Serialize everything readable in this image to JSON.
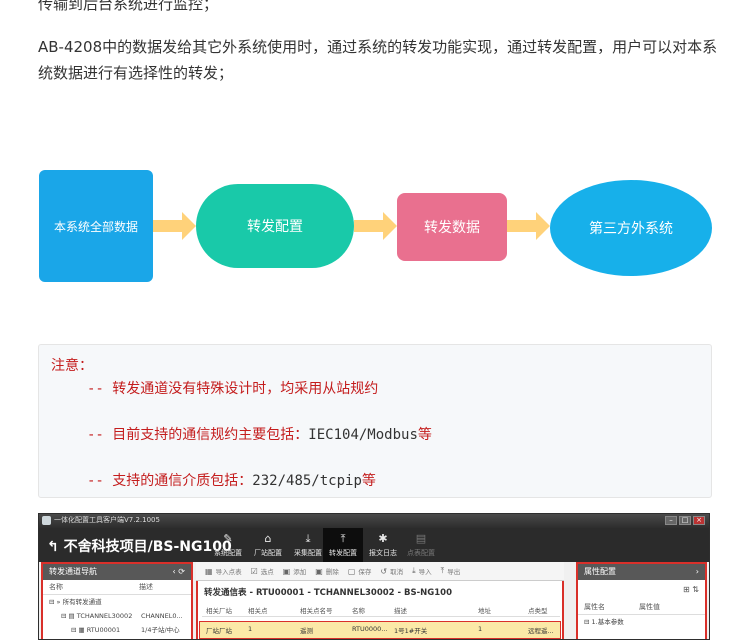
{
  "paragraphs": {
    "p1": "传输到后台系统进行监控；",
    "p2": "AB-4208中的数据发给其它外系统使用时，通过系统的转发功能实现，通过转发配置，用户可以对本系统数据进行有选择性的转发；"
  },
  "flow": {
    "nodes": [
      "本系统全部数据",
      "转发配置",
      "转发数据",
      "第三方外系统"
    ],
    "colors": {
      "node1": "#1aa6e8",
      "node2": "#19c9a9",
      "node3": "#e9708f",
      "node4": "#17b0ea",
      "arrow": "#ffd27a"
    }
  },
  "note": {
    "title": "注意：",
    "items": [
      {
        "prefix": "-- ",
        "text": "转发通道没有特殊设计时，均采用从站规约"
      },
      {
        "prefix": "-- ",
        "text": "目前支持的通信规约主要包括：",
        "mono": "IEC104/Modbus",
        "suffix": "等"
      },
      {
        "prefix": "-- ",
        "text": "支持的通信介质包括：",
        "mono": "232/485/tcpip",
        "suffix": "等"
      }
    ]
  },
  "app": {
    "window_title": "一体化配置工具客户端V7.2.1005",
    "project_title": "不舍科技项目/BS-NG100",
    "nav": [
      {
        "label": "系统配置",
        "icon": "wrench-icon"
      },
      {
        "label": "厂站配置",
        "icon": "home-icon"
      },
      {
        "label": "采集配置",
        "icon": "download-icon"
      },
      {
        "label": "转发配置",
        "icon": "upload-icon"
      },
      {
        "label": "报文日志",
        "icon": "bug-icon"
      },
      {
        "label": "点表配置",
        "icon": "file-icon"
      }
    ],
    "left_panel": {
      "title": "转发通道导航",
      "columns": [
        "名称",
        "描述"
      ],
      "rows": [
        {
          "name": "所有转发通道",
          "desc": ""
        },
        {
          "name": "TCHANNEL30002",
          "desc": "CHANNEL0..."
        },
        {
          "name": "RTU00001",
          "desc": "1/4子站/中心"
        }
      ]
    },
    "toolbar": [
      "导入点表",
      "选点",
      "添加",
      "删除",
      "保存",
      "取消",
      "导入",
      "导出"
    ],
    "main": {
      "title": "转发通信表 - RTU00001 - TCHANNEL30002 - BS-NG100",
      "columns": [
        "相关厂站",
        "相关点",
        "相关点名号",
        "名称",
        "描述",
        "地址",
        "点类型"
      ],
      "row": [
        "厂站厂站",
        "1",
        "遥测",
        "RTU0000...",
        "1号1#开关",
        "1",
        "远程遥..."
      ]
    },
    "right_panel": {
      "title": "属性配置",
      "columns": [
        "属性名",
        "属性值"
      ],
      "rows": [
        "1.基本参数"
      ]
    }
  }
}
